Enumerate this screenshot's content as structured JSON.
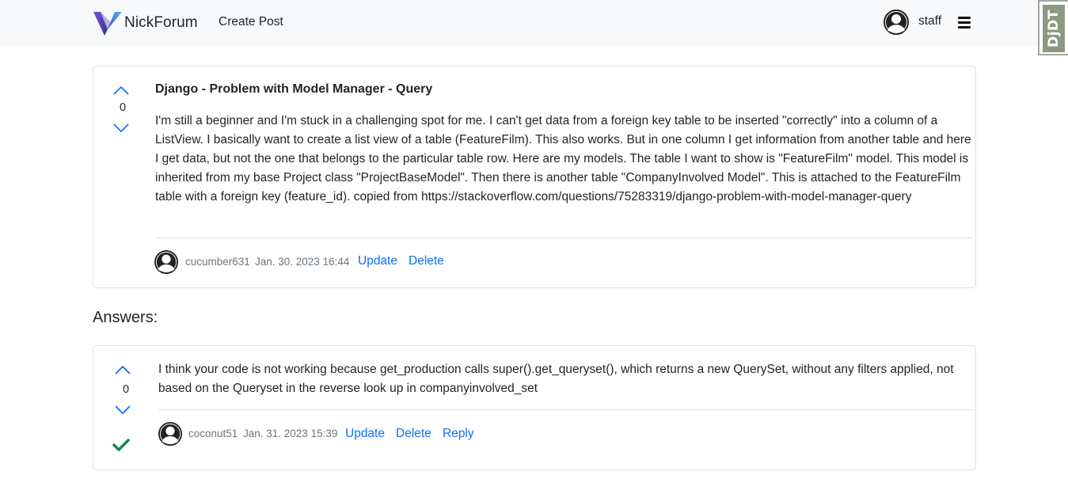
{
  "navbar": {
    "brand": "NickForum",
    "create_post": "Create Post",
    "username": "staff"
  },
  "djdt": {
    "label": "DjDT"
  },
  "question": {
    "votes": "0",
    "title": "Django - Problem with Model Manager - Query",
    "body": "I'm still a beginner and I'm stuck in a challenging spot for me. I can't get data from a foreign key table to be inserted \"correctly\" into a column of a ListView. I basically want to create a list view of a table (FeatureFilm). This also works. But in one column I get information from another table and here I get data, but not the one that belongs to the particular table row. Here are my models. The table I want to show is \"FeatureFilm\" model. This model is inherited from my base Project class \"ProjectBaseModel\". Then there is another table \"CompanyInvolved Model\". This is attached to the FeatureFilm table with a foreign key (feature_id). copied from https://stackoverflow.com/questions/75283319/django-problem-with-model-manager-query",
    "author": "cucumber631",
    "date": "Jan. 30. 2023 16:44",
    "update_label": "Update",
    "delete_label": "Delete"
  },
  "answers_heading": "Answers:",
  "answers": [
    {
      "votes": "0",
      "body": "I think your code is not working because get_production calls super().get_queryset(), which returns a new QuerySet, without any filters applied, not based on the Queryset in the reverse look up in companyinvolved_set",
      "author": "coconut51",
      "date": "Jan. 31. 2023 15:39",
      "update_label": "Update",
      "delete_label": "Delete",
      "reply_label": "Reply",
      "accepted": true
    }
  ],
  "colors": {
    "link": "#0d6efd",
    "accepted": "#198754",
    "navbar_bg": "#f8f9fa",
    "card_border": "#dee2e6"
  },
  "icons": [
    "brand-logo-icon",
    "user-avatar-icon",
    "menu-icon",
    "vote-up-icon",
    "vote-down-icon",
    "check-icon"
  ]
}
